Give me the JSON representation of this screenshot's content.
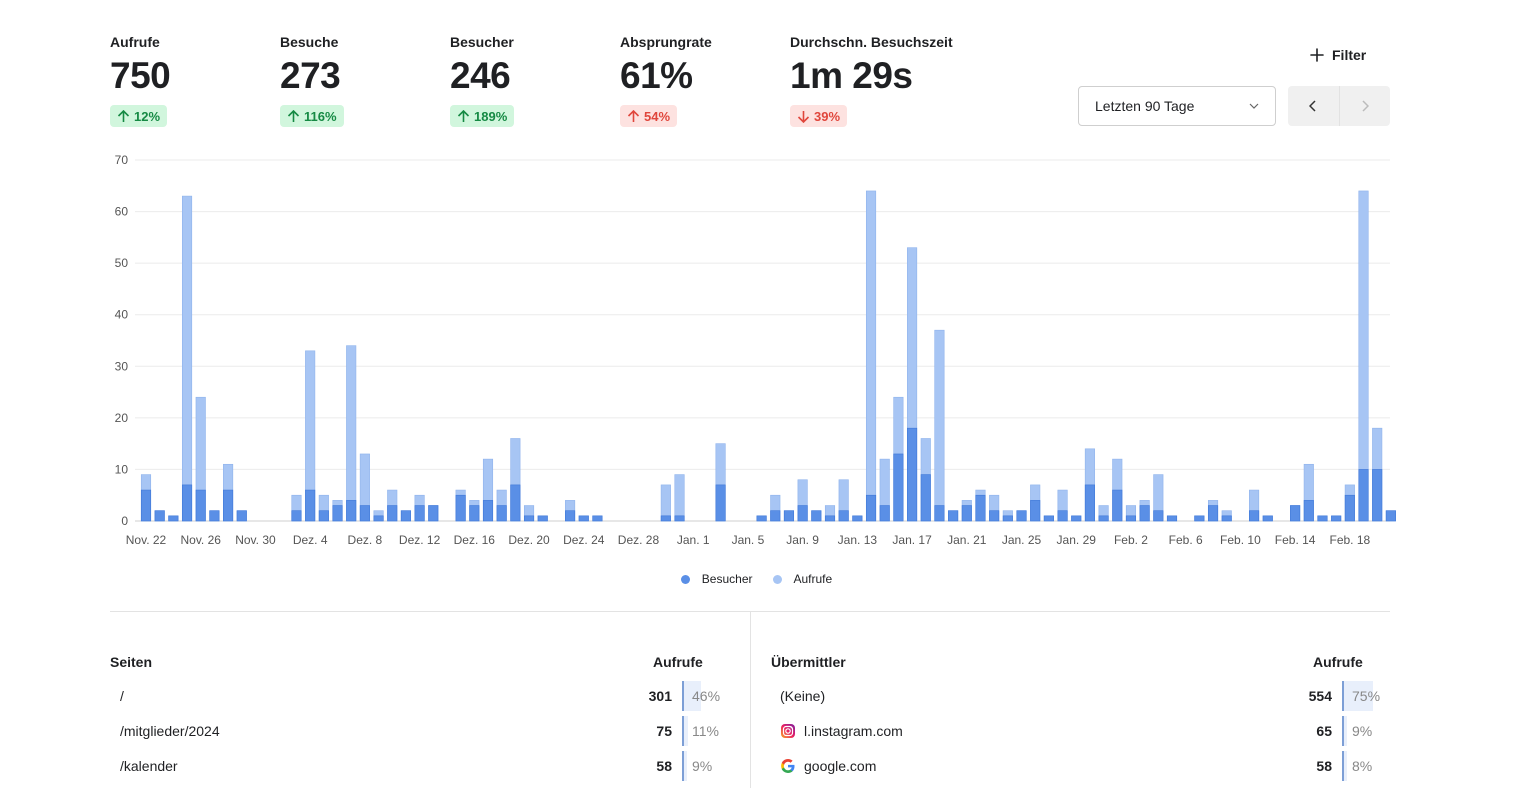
{
  "metrics": [
    {
      "label": "Aufrufe",
      "value": "750",
      "change": "12%",
      "trend": "up",
      "tone": "good"
    },
    {
      "label": "Besuche",
      "value": "273",
      "change": "116%",
      "trend": "up",
      "tone": "good"
    },
    {
      "label": "Besucher",
      "value": "246",
      "change": "189%",
      "trend": "up",
      "tone": "good"
    },
    {
      "label": "Absprungrate",
      "value": "61%",
      "change": "54%",
      "trend": "up",
      "tone": "bad"
    },
    {
      "label": "Durchschn. Besuchszeit",
      "value": "1m 29s",
      "change": "39%",
      "trend": "down",
      "tone": "bad"
    }
  ],
  "controls": {
    "filter_label": "Filter",
    "date_range": "Letzten 90 Tage"
  },
  "colors": {
    "visitors": "#5a8fe6",
    "pageviews": "#a7c5f4",
    "good": "#168a44",
    "bad": "#e0463c"
  },
  "chart_data": {
    "type": "bar",
    "stacked": true,
    "ylim": [
      0,
      70
    ],
    "yticks": [
      0,
      10,
      20,
      30,
      40,
      50,
      60,
      70
    ],
    "xtick_labels": [
      "Nov. 22",
      "Nov. 26",
      "Nov. 30",
      "Dez. 4",
      "Dez. 8",
      "Dez. 12",
      "Dez. 16",
      "Dez. 20",
      "Dez. 24",
      "Dez. 28",
      "Jan. 1",
      "Jan. 5",
      "Jan. 9",
      "Jan. 13",
      "Jan. 17",
      "Jan. 21",
      "Jan. 25",
      "Jan. 29",
      "Feb. 2",
      "Feb. 6",
      "Feb. 10",
      "Feb. 14",
      "Feb. 18"
    ],
    "days": 91,
    "series": [
      {
        "name": "Besucher",
        "values": [
          6,
          2,
          1,
          7,
          6,
          2,
          6,
          2,
          0,
          0,
          0,
          2,
          6,
          2,
          3,
          4,
          3,
          1,
          3,
          2,
          3,
          3,
          0,
          5,
          3,
          4,
          3,
          7,
          1,
          1,
          0,
          2,
          1,
          1,
          0,
          0,
          0,
          0,
          1,
          1,
          0,
          0,
          7,
          0,
          0,
          1,
          2,
          2,
          3,
          2,
          1,
          2,
          1,
          5,
          3,
          13,
          18,
          9,
          3,
          2,
          3,
          5,
          2,
          1,
          2,
          4,
          1,
          2,
          1,
          7,
          1,
          6,
          1,
          3,
          2,
          1,
          0,
          1,
          3,
          1,
          0,
          2,
          1,
          0,
          3,
          4,
          1,
          1,
          5,
          10,
          10,
          2
        ]
      },
      {
        "name": "Aufrufe",
        "values": [
          9,
          2,
          1,
          63,
          24,
          2,
          11,
          2,
          0,
          0,
          0,
          5,
          33,
          5,
          4,
          34,
          13,
          2,
          6,
          2,
          5,
          3,
          0,
          6,
          4,
          12,
          6,
          16,
          3,
          1,
          0,
          4,
          1,
          1,
          0,
          0,
          0,
          0,
          7,
          9,
          0,
          0,
          15,
          0,
          0,
          1,
          5,
          2,
          8,
          2,
          3,
          8,
          1,
          64,
          12,
          24,
          53,
          16,
          37,
          2,
          4,
          6,
          5,
          2,
          2,
          7,
          1,
          6,
          1,
          14,
          3,
          12,
          3,
          4,
          9,
          1,
          0,
          1,
          4,
          2,
          0,
          6,
          1,
          0,
          3,
          11,
          1,
          1,
          7,
          64,
          18,
          2
        ]
      }
    ],
    "legend": [
      "Besucher",
      "Aufrufe"
    ]
  },
  "pages_table": {
    "title": "Seiten",
    "metric_header": "Aufrufe",
    "rows": [
      {
        "name": "/",
        "value": "301",
        "percent": "46%",
        "share": 0.46
      },
      {
        "name": "/mitglieder/2024",
        "value": "75",
        "percent": "11%",
        "share": 0.11
      },
      {
        "name": "/kalender",
        "value": "58",
        "percent": "9%",
        "share": 0.09
      }
    ]
  },
  "referrers_table": {
    "title": "Übermittler",
    "metric_header": "Aufrufe",
    "rows": [
      {
        "name": "(Keine)",
        "value": "554",
        "percent": "75%",
        "share": 0.75,
        "icon": ""
      },
      {
        "name": "l.instagram.com",
        "value": "65",
        "percent": "9%",
        "share": 0.09,
        "icon": "instagram-icon"
      },
      {
        "name": "google.com",
        "value": "58",
        "percent": "8%",
        "share": 0.08,
        "icon": "google-icon"
      }
    ]
  }
}
